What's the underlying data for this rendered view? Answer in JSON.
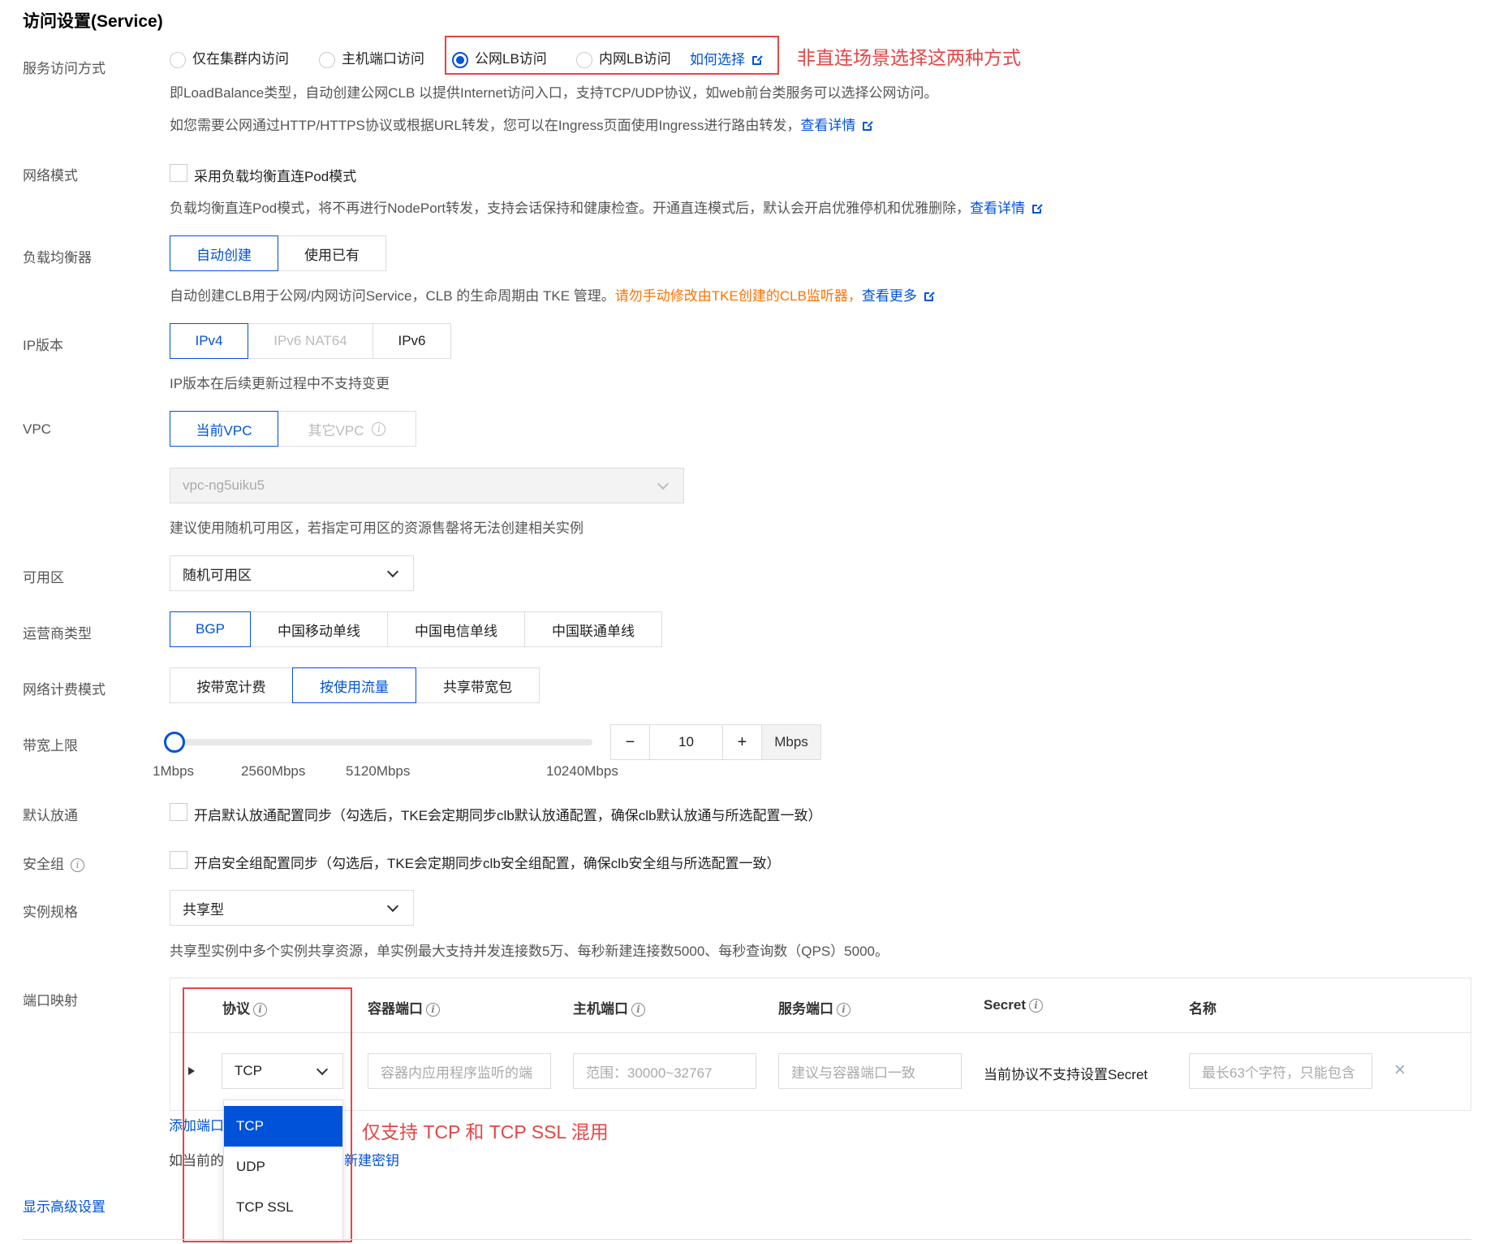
{
  "title": "访问设置(Service)",
  "labels": {
    "access_mode": "服务访问方式",
    "network_mode": "网络模式",
    "load_balancer": "负载均衡器",
    "ip_version": "IP版本",
    "vpc": "VPC",
    "zone": "可用区",
    "isp": "运营商类型",
    "billing": "网络计费模式",
    "bandwidth": "带宽上限",
    "default_allow": "默认放通",
    "security_group": "安全组",
    "instance_spec": "实例规格",
    "port_mapping": "端口映射"
  },
  "access_mode": {
    "options": [
      "仅在集群内访问",
      "主机端口访问",
      "公网LB访问",
      "内网LB访问"
    ],
    "selected": "公网LB访问",
    "how_to_choose": "如何选择",
    "annotation": "非直连场景选择这两种方式",
    "hint1": "即LoadBalance类型，自动创建公网CLB 以提供Internet访问入口，支持TCP/UDP协议，如web前台类服务可以选择公网访问。",
    "hint2": "如您需要公网通过HTTP/HTTPS协议或根据URL转发，您可以在Ingress页面使用Ingress进行路由转发，",
    "hint2_link": "查看详情"
  },
  "network_mode": {
    "checkbox_label": "采用负载均衡直连Pod模式",
    "hint": "负载均衡直连Pod模式，将不再进行NodePort转发，支持会话保持和健康检查。开通直连模式后，默认会开启优雅停机和优雅删除，",
    "hint_link": "查看详情"
  },
  "load_balancer": {
    "options": [
      "自动创建",
      "使用已有"
    ],
    "selected": "自动创建",
    "hint": "自动创建CLB用于公网/内网访问Service，CLB 的生命周期由 TKE 管理。",
    "warn": "请勿手动修改由TKE创建的CLB监听器，",
    "link": "查看更多"
  },
  "ip_version": {
    "options": [
      "IPv4",
      "IPv6 NAT64",
      "IPv6"
    ],
    "selected": "IPv4",
    "hint": "IP版本在后续更新过程中不支持变更"
  },
  "vpc": {
    "options": [
      "当前VPC",
      "其它VPC"
    ],
    "selected": "当前VPC",
    "value": "vpc-ng5uiku5",
    "hint": "建议使用随机可用区，若指定可用区的资源售罄将无法创建相关实例"
  },
  "zone": {
    "value": "随机可用区"
  },
  "isp": {
    "options": [
      "BGP",
      "中国移动单线",
      "中国电信单线",
      "中国联通单线"
    ],
    "selected": "BGP"
  },
  "billing": {
    "options": [
      "按带宽计费",
      "按使用流量",
      "共享带宽包"
    ],
    "selected": "按使用流量"
  },
  "bandwidth": {
    "ticks": [
      "1Mbps",
      "2560Mbps",
      "5120Mbps",
      "10240Mbps"
    ],
    "value": "10",
    "unit": "Mbps",
    "minus": "−",
    "plus": "+"
  },
  "default_allow": {
    "checkbox_label": "开启默认放通配置同步（勾选后，TKE会定期同步clb默认放通配置，确保clb默认放通与所选配置一致）"
  },
  "security_group": {
    "checkbox_label": "开启安全组配置同步（勾选后，TKE会定期同步clb安全组配置，确保clb安全组与所选配置一致）"
  },
  "instance_spec": {
    "value": "共享型",
    "hint": "共享型实例中多个实例共享资源，单实例最大支持并发连接数5万、每秒新建连接数5000、每秒查询数（QPS）5000。"
  },
  "port_mapping": {
    "headers": [
      "协议",
      "容器端口",
      "主机端口",
      "服务端口",
      "Secret",
      "名称"
    ],
    "row": {
      "protocol": "TCP",
      "container_port_placeholder": "容器内应用程序监听的端",
      "host_port_placeholder": "范围：30000~32767",
      "service_port_placeholder": "建议与容器端口一致",
      "secret_text": "当前协议不支持设置Secret",
      "name_placeholder": "最长63个字符，只能包含"
    },
    "dropdown_options": [
      "TCP",
      "UDP",
      "TCP SSL"
    ],
    "dropdown_selected": "TCP",
    "add_port": "添加端口",
    "note_prefix": "如当前的",
    "note_link": "新建密钥",
    "annotation": "仅支持 TCP 和 TCP SSL 混用"
  },
  "advanced": "显示高级设置"
}
